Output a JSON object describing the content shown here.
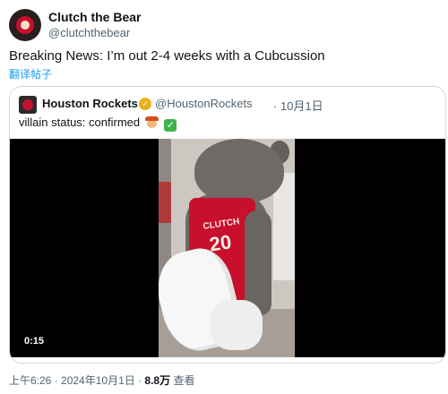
{
  "author": {
    "display_name": "Clutch the Bear",
    "handle": "@clutchthebear",
    "avatar_icon": "clutch-bear-avatar"
  },
  "tweet": {
    "text": "Breaking News: I’m out 2-4 weeks with a Cubcussion",
    "translate_label": "翻译帖子"
  },
  "quoted": {
    "display_name": "Houston Rockets",
    "verified_icon": "gold-verified-badge",
    "handle": "@HoustonRockets",
    "date": "· 10月1日",
    "text": "villain status: confirmed",
    "emojis": [
      "villain-emoji",
      "check-mark-emoji"
    ],
    "video": {
      "jersey_name": "CLUTCH",
      "jersey_number": "20",
      "duration": "0:15"
    }
  },
  "meta": {
    "time": "上午6:26",
    "sep1": " · ",
    "date": "2024年10月1日",
    "sep2": " · ",
    "views": "8.8万",
    "views_label": " 查看"
  },
  "colors": {
    "link_blue": "#1d9bf0",
    "rockets_red": "#c8102e",
    "muted_text": "#536471"
  }
}
